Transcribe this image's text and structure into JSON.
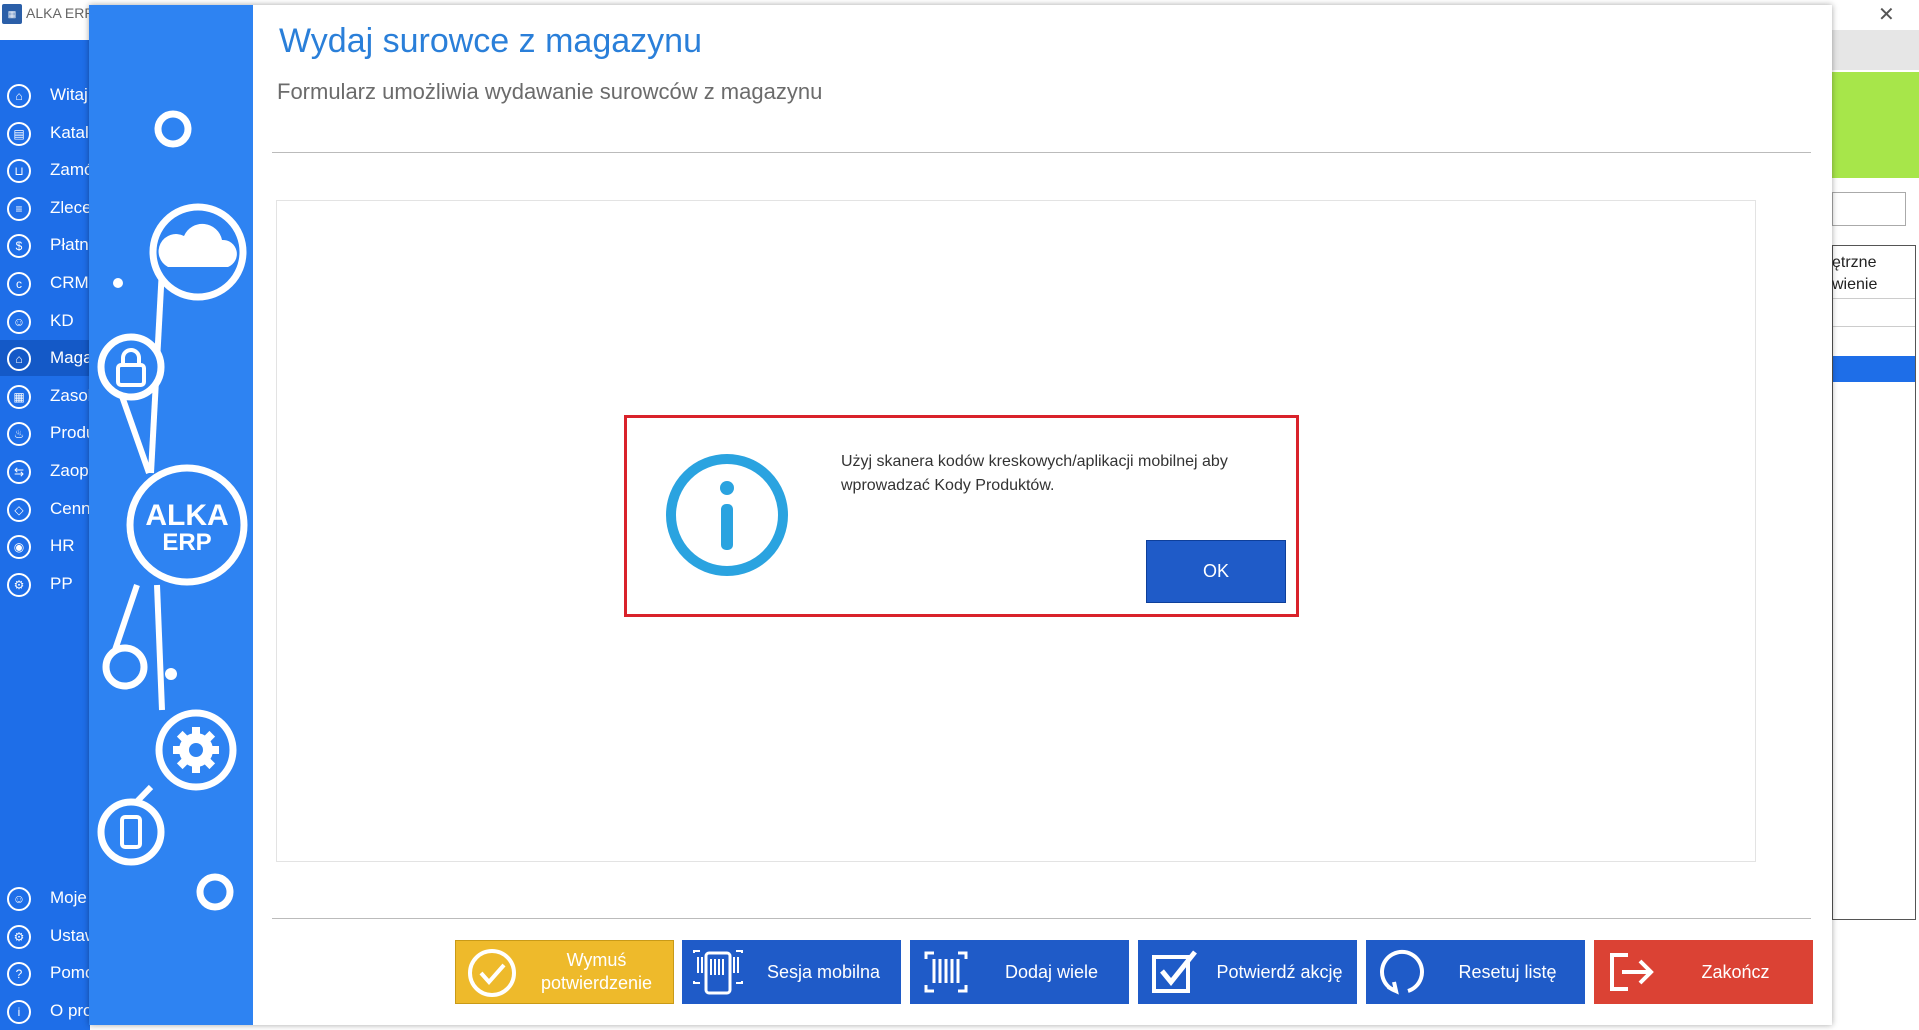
{
  "background_app": {
    "title": "ALKA ERP",
    "nav_items": [
      {
        "label": "Witaj",
        "icon": "home-icon"
      },
      {
        "label": "Katalo",
        "icon": "book-icon"
      },
      {
        "label": "Zamó",
        "icon": "cart-icon"
      },
      {
        "label": "Zlece",
        "icon": "list-icon"
      },
      {
        "label": "Płatn",
        "icon": "dollar-icon"
      },
      {
        "label": "CRM",
        "icon": "crm-icon"
      },
      {
        "label": "KD",
        "icon": "person-icon"
      },
      {
        "label": "Maga",
        "icon": "warehouse-icon"
      },
      {
        "label": "Zasob",
        "icon": "building-icon"
      },
      {
        "label": "Produ",
        "icon": "production-icon"
      },
      {
        "label": "Zaop",
        "icon": "truck-icon"
      },
      {
        "label": "Cenn",
        "icon": "tag-icon"
      },
      {
        "label": "HR",
        "icon": "hr-icon"
      },
      {
        "label": "PP",
        "icon": "pp-icon"
      }
    ],
    "bottom_nav_items": [
      {
        "label": "Moje",
        "icon": "user-icon"
      },
      {
        "label": "Ustaw",
        "icon": "settings-icon"
      },
      {
        "label": "Pomo",
        "icon": "help-icon"
      },
      {
        "label": "O pro",
        "icon": "info-icon"
      }
    ],
    "right_table_header_line1": "ętrzne",
    "right_table_header_line2": "wienie"
  },
  "form": {
    "title": "Wydaj surowce z magazynu",
    "subtitle": "Formularz umożliwia wydawanie surowców z magazynu",
    "logo_line1": "ALKA",
    "logo_line2": "ERP"
  },
  "dialog": {
    "message": "Użyj skanera kodów kreskowych/aplikacji mobilnej aby wprowadzać Kody Produktów.",
    "ok_label": "OK",
    "icon": "info-icon"
  },
  "buttons": {
    "force_confirm_line1": "Wymuś",
    "force_confirm_line2": "potwierdzenie",
    "mobile_session": "Sesja mobilna",
    "add_many": "Dodaj wiele",
    "confirm_action": "Potwierdź akcję",
    "reset_list": "Resetuj listę",
    "finish": "Zakończ"
  },
  "colors": {
    "accent_blue": "#1f5bc8",
    "sidebar_blue": "#2e83f2",
    "title_blue": "#2a7fd9",
    "warning_yellow": "#eeba2b",
    "danger_red": "#db4234",
    "dialog_border": "#d9222a",
    "info_icon": "#2aa3e0"
  }
}
